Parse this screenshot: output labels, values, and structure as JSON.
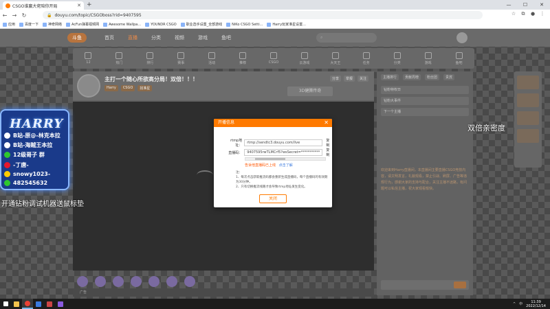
{
  "browser": {
    "tab_title": "CSGO谁赢大佬陪你开局",
    "url": "douyu.com/topic/CSGOboss?rid=9407595",
    "bookmarks": [
      "应用",
      "百度一下",
      "神奇网络",
      "AcFun弹幕视频网",
      "Awesome Wallpa...",
      "YOUNDR CSGO",
      "职业选手设置_全部游戏",
      "NiKo CSGO Setti...",
      "Harry玩家准星设置..."
    ]
  },
  "douyu": {
    "logo": "斗鱼",
    "nav": [
      "首页",
      "直播",
      "分类",
      "视频",
      "游戏",
      "鱼吧"
    ],
    "active_nav": "直播",
    "categories": [
      "12",
      "热门",
      "排行",
      "赛事",
      "活动",
      "推荐",
      "CSGO",
      "云游戏",
      "大天王",
      "任务",
      "分类",
      "游戏",
      "鱼吧"
    ],
    "room_title": "主打一个随心所欲高分局！双倍！！！",
    "room_tags": [
      "Harry",
      "CSGO",
      "找准星"
    ],
    "room_header_buttons": [
      "分享",
      "举报",
      "关注"
    ],
    "sponsor_text": "3D健腾传奇",
    "player_footer": "广告",
    "side_tabs": [
      "主播排行",
      "贡献周榜",
      "粉丝团",
      "贵宾"
    ],
    "side_rows": [
      "钻粉特权日",
      "钻粉大事件",
      "下一个主播"
    ],
    "chat_excerpt": "欢迎来到Harry直播间，本直播间主要直播CSGO竞技内容，请文明发言，礼貌观看，禁止引战、刷屏、广告等违规行为，感谢大家的支持与配合，关注主播不迷路，有问题可以私信主播，祝大家观看愉快。"
  },
  "overlay": {
    "logo_text": "HARRY",
    "lines": [
      {
        "icon": "bilibili-icon",
        "text": "B站-原@-林克本拉"
      },
      {
        "icon": "kuaishou-icon",
        "text": "B站-海贼王本拉"
      },
      {
        "icon": "wechat-icon",
        "text": "12级哥子 群"
      },
      {
        "icon": "weibo-icon",
        "text": "-丁唐-"
      },
      {
        "icon": "qq-icon",
        "text": "snowy1023-"
      },
      {
        "icon": "qq-group-icon",
        "text": "482545632"
      }
    ],
    "right_text": "双倍亲密度",
    "left_text": "开通钻粉调试机器送鼠标垫",
    "brand_colors": {
      "card": "#1a3a8a",
      "border": "#8ab8ff"
    }
  },
  "dialog": {
    "title": "开播信息",
    "rtmp_label": "rtmp地址：",
    "rtmp_value": "rtmp://sendtc3.douyu.com/live",
    "stream_label": "直播码：",
    "stream_value": "9407595rwTLMCrf5?wsSecret=***********",
    "copy_label": "复制",
    "warn_text": "告诉他直播码已上线",
    "warn_link": "点击了解",
    "notes_title": "注：",
    "notes": [
      "1、每次点击获取推流码都会重新生成直播码，每个直播码的有效期为30分钟。",
      "2、只有切换推流线路才会导致rtmp地址发生变化。"
    ],
    "close_button": "关闭",
    "accent": "#ff7a00"
  },
  "taskbar": {
    "time": "11:39",
    "date": "2022/12/14",
    "tray_items": [
      "^",
      "中"
    ]
  }
}
